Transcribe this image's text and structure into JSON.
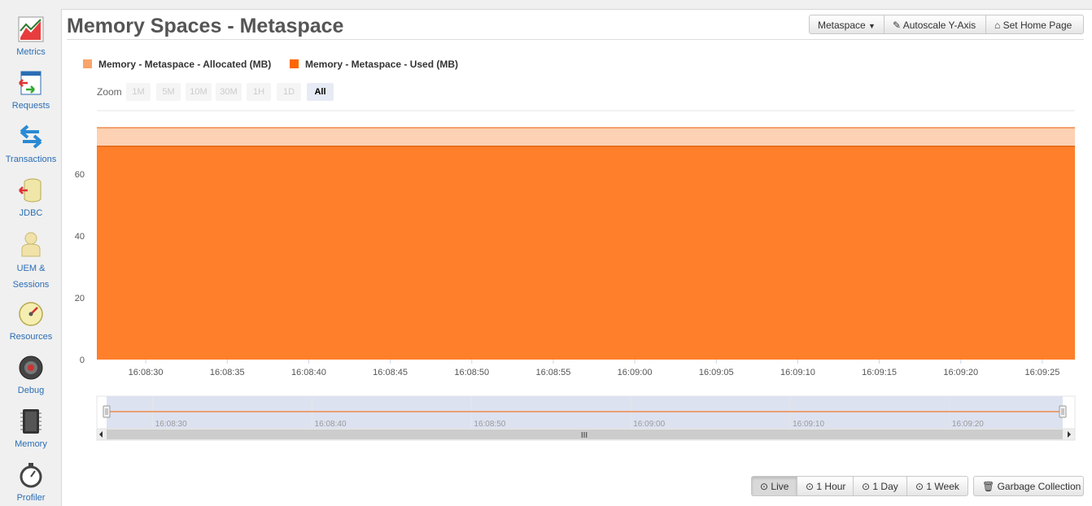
{
  "sidebar": {
    "items": [
      {
        "label": "Metrics",
        "icon": "line-chart-icon"
      },
      {
        "label": "Requests",
        "icon": "requests-icon"
      },
      {
        "label": "Transactions",
        "icon": "transactions-icon"
      },
      {
        "label": "JDBC",
        "icon": "database-icon"
      },
      {
        "label": "UEM &",
        "label2": "Sessions",
        "icon": "user-icon"
      },
      {
        "label": "Resources",
        "icon": "gauge-icon"
      },
      {
        "label": "Debug",
        "icon": "debug-icon"
      },
      {
        "label": "Memory",
        "icon": "memory-chip-icon"
      },
      {
        "label": "Profiler",
        "icon": "stopwatch-icon"
      }
    ]
  },
  "header": {
    "title": "Memory Spaces - Metaspace",
    "metaspace_dropdown": "Metaspace",
    "autoscale_label": "Autoscale Y-Axis",
    "home_label": "Set Home Page"
  },
  "legend": {
    "allocated": "Memory - Metaspace - Allocated (MB)",
    "used": "Memory - Metaspace - Used (MB)"
  },
  "zoom": {
    "label": "Zoom",
    "options": [
      "1M",
      "5M",
      "10M",
      "30M",
      "1H",
      "1D",
      "All"
    ],
    "selected": "All"
  },
  "chart_data": {
    "type": "area",
    "x": [
      "16:08:27",
      "16:09:27"
    ],
    "series": [
      {
        "name": "Memory - Metaspace - Allocated (MB)",
        "values": [
          75,
          75
        ],
        "color": "#f8a46a"
      },
      {
        "name": "Memory - Metaspace - Used (MB)",
        "values": [
          69,
          69
        ],
        "color": "#ff7f2a"
      }
    ],
    "x_ticks": [
      "16:08:30",
      "16:08:35",
      "16:08:40",
      "16:08:45",
      "16:08:50",
      "16:08:55",
      "16:09:00",
      "16:09:05",
      "16:09:10",
      "16:09:15",
      "16:09:20",
      "16:09:25"
    ],
    "y_ticks": [
      0,
      20,
      40,
      60
    ],
    "ylim": [
      0,
      80
    ],
    "navigator_ticks": [
      "16:08:30",
      "16:08:40",
      "16:08:50",
      "16:09:00",
      "16:09:10",
      "16:09:20"
    ],
    "legend_position": "top-left"
  },
  "footer": {
    "live": "Live",
    "hour": "1 Hour",
    "day": "1 Day",
    "week": "1 Week",
    "gc": "Garbage Collection"
  },
  "colors": {
    "allocated": "#f8a46a",
    "used": "#ff7f2a",
    "link": "#2a6db5"
  }
}
